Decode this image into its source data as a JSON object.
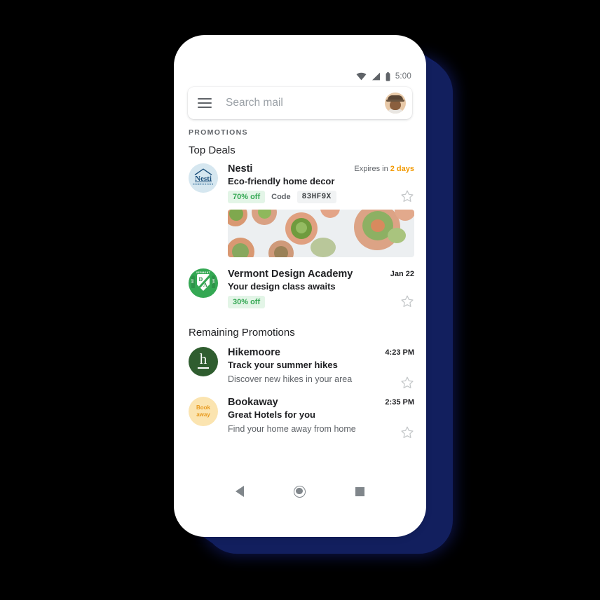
{
  "status_bar": {
    "time": "5:00",
    "icons": [
      "wifi-icon",
      "cellular-signal-icon",
      "battery-icon"
    ]
  },
  "search": {
    "menu_icon": "hamburger-menu-icon",
    "placeholder": "Search mail",
    "avatar_icon": "user-avatar"
  },
  "category_label": "PROMOTIONS",
  "sections": [
    {
      "title": "Top Deals"
    },
    {
      "title": "Remaining Promotions"
    }
  ],
  "top_deals": [
    {
      "logo_name": "nesti-logo",
      "logo_text": "Nesti",
      "logo_subtext": "HOMEGOODS",
      "sender": "Nesti",
      "meta_prefix": "Expires in ",
      "meta_highlight": "2 days",
      "subject": "Eco-friendly home decor",
      "discount": "70% off",
      "code_label": "Code",
      "code_value": "83HF9X",
      "has_image": true,
      "image_alt": "potted succulents overhead",
      "star": "star-outline-icon"
    },
    {
      "logo_name": "vermont-logo",
      "logo_arc": "VERMONT",
      "logo_left": "EST",
      "logo_right": "1961",
      "logo_mark_d": "D",
      "logo_mark_a": "A",
      "sender": "Vermont Design Academy",
      "meta_prefix": "",
      "meta_highlight": "Jan 22",
      "subject": "Your design class awaits",
      "discount": "30% off",
      "has_image": false,
      "star": "star-outline-icon"
    }
  ],
  "remaining_promotions": [
    {
      "logo_name": "hikemoore-logo",
      "logo_text": "h",
      "sender": "Hikemoore",
      "time": "4:23 PM",
      "subject": "Track your summer hikes",
      "snippet": "Discover new hikes in your area",
      "star": "star-outline-icon"
    },
    {
      "logo_name": "bookaway-logo",
      "logo_line1": "Book",
      "logo_line2": "away",
      "sender": "Bookaway",
      "time": "2:35 PM",
      "subject": "Great Hotels for you",
      "snippet": "Find your home away from home",
      "star": "star-outline-icon"
    }
  ],
  "nav_bar": {
    "back": "back-triangle-icon",
    "home": "home-circle-icon",
    "recents": "recents-square-icon"
  },
  "colors": {
    "accent_green": "#34a853",
    "chip_green_bg": "#e3f5e7",
    "expiry_orange": "#f29900",
    "text_primary": "#202124",
    "text_secondary": "#5f6368",
    "backdrop_navy": "#121f5e",
    "page_background": "#000000"
  }
}
